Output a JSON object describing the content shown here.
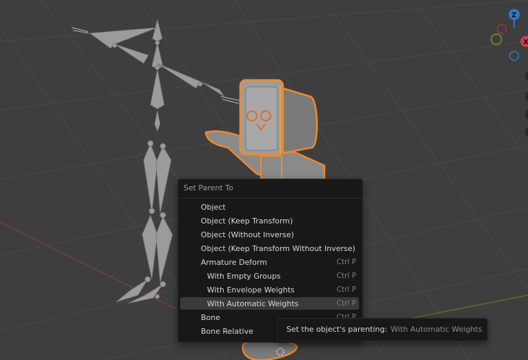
{
  "menu": {
    "title": "Set Parent To",
    "items": [
      {
        "label": "Object",
        "shortcut": ""
      },
      {
        "label": "Object (Keep Transform)",
        "shortcut": ""
      },
      {
        "label": "Object (Without Inverse)",
        "shortcut": ""
      },
      {
        "label": "Object (Keep Transform Without Inverse)",
        "shortcut": ""
      },
      {
        "label": "Armature Deform",
        "shortcut": "Ctrl P"
      },
      {
        "label": "With Empty Groups",
        "shortcut": "Ctrl P"
      },
      {
        "label": "With Envelope Weights",
        "shortcut": "Ctrl P"
      },
      {
        "label": "With Automatic Weights",
        "shortcut": "Ctrl P"
      },
      {
        "label": "Bone",
        "shortcut": "Ctrl P"
      },
      {
        "label": "Bone Relative",
        "shortcut": ""
      }
    ]
  },
  "tooltip": {
    "label": "Set the object's parenting:",
    "value": "With Automatic Weights"
  },
  "gizmo": {
    "z_label": "Z",
    "x_label": "X",
    "colors": {
      "x": "#d63a4a",
      "y": "#6a9b23",
      "z": "#2f78c8"
    }
  },
  "colors": {
    "selection_outline": "#f08a2a",
    "menu_bg": "#181818",
    "highlight": "#3a3a3a"
  }
}
